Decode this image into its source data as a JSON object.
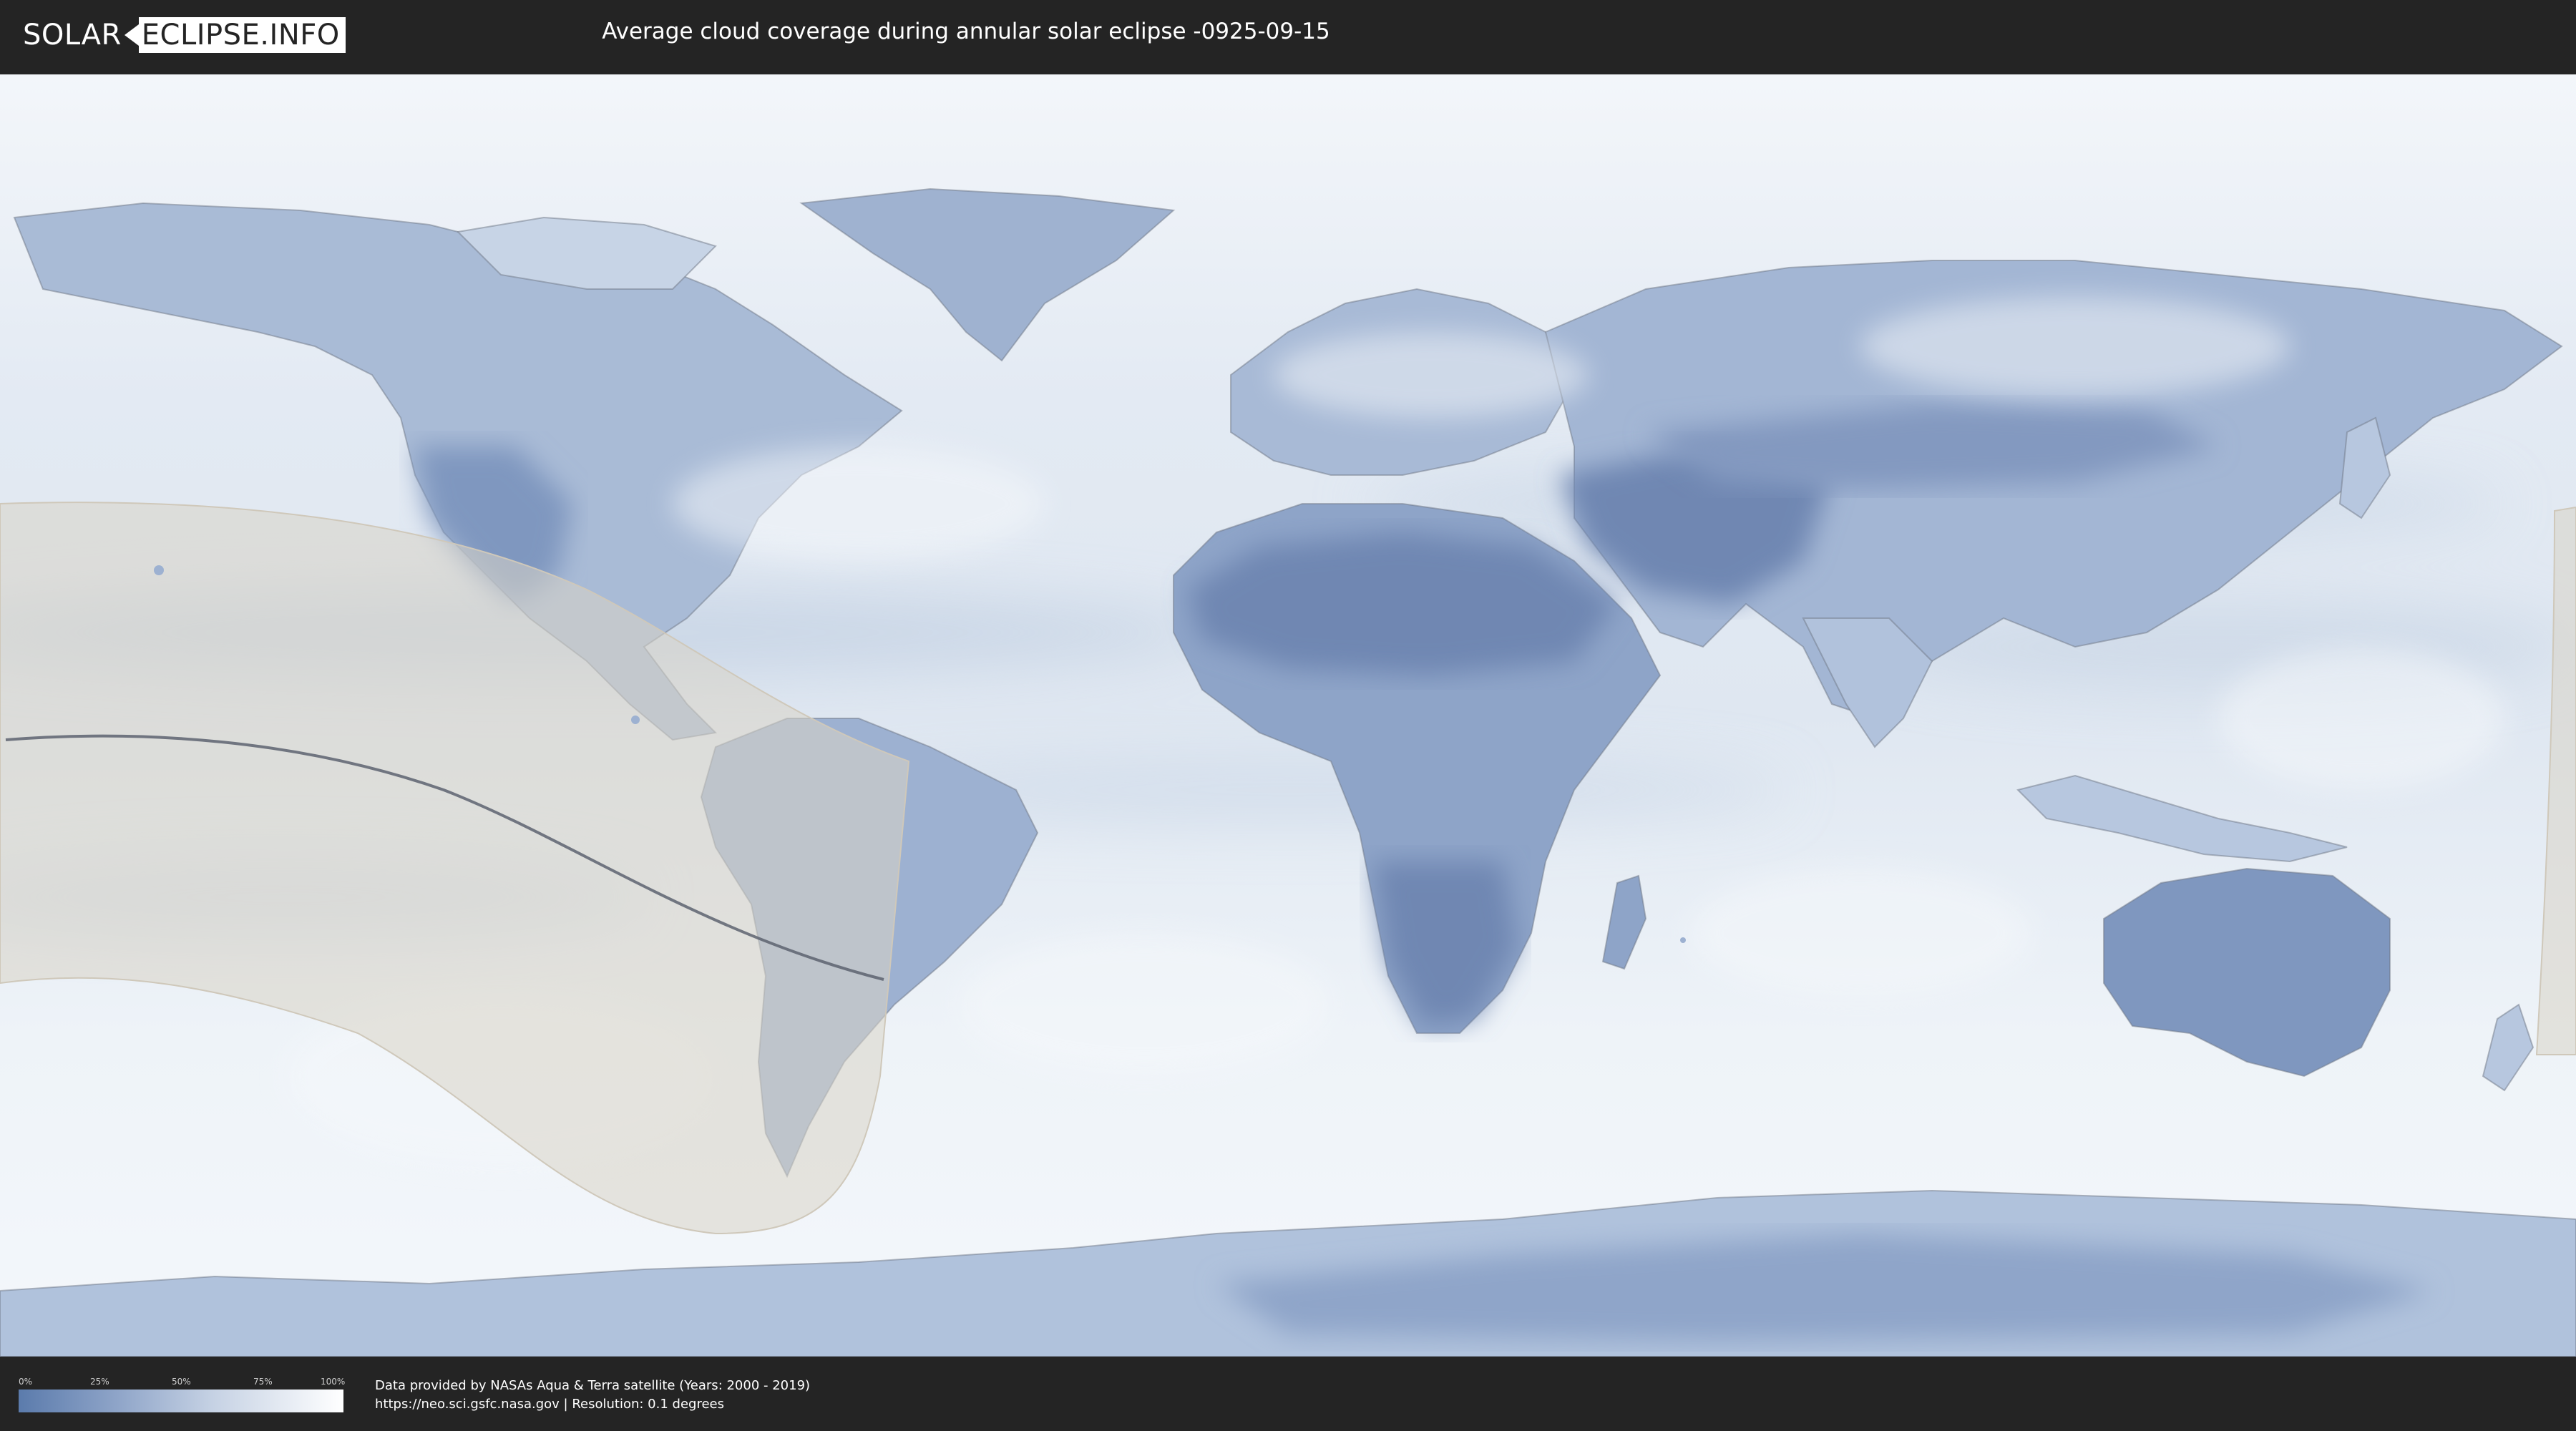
{
  "header": {
    "logo_left": "SOLAR",
    "logo_right": "ECLIPSE.INFO",
    "title": "Average cloud coverage during annular solar eclipse -0925-09-15"
  },
  "map": {
    "ocean_color": "#e6edf5",
    "land_color": "#7f97bf",
    "dark_land_color": "#6f87b2",
    "cloud_color": "#f2f6fa",
    "eclipse_shadow_color": "#d9d3c7",
    "central_line_color": "#5d6370",
    "border_color": "#6f7885"
  },
  "legend": {
    "ticks": [
      "0%",
      "25%",
      "50%",
      "75%",
      "100%"
    ],
    "gradient_start": "#5b7bac",
    "gradient_end": "#ffffff"
  },
  "footer": {
    "credit_line_1": "Data provided by NASAs Aqua & Terra satellite (Years: 2000 - 2019)",
    "credit_line_2": "https://neo.sci.gsfc.nasa.gov | Resolution: 0.1 degrees"
  }
}
